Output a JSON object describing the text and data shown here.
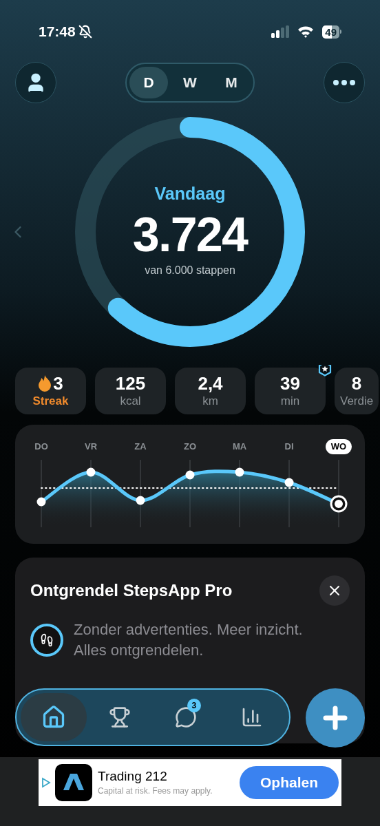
{
  "status_bar": {
    "time": "17:48",
    "battery": "49"
  },
  "period_tabs": [
    {
      "label": "D",
      "selected": true
    },
    {
      "label": "W",
      "selected": false
    },
    {
      "label": "M",
      "selected": false
    }
  ],
  "progress": {
    "title": "Vandaag",
    "steps": "3.724",
    "goal": "van 6.000 stappen",
    "level": 0.62
  },
  "stats": [
    {
      "kind": "streak",
      "value": "3",
      "label": "Streak",
      "badge": false
    },
    {
      "kind": "plain",
      "value": "125",
      "label": "kcal",
      "badge": false
    },
    {
      "kind": "plain",
      "value": "2,4",
      "label": "km",
      "badge": false
    },
    {
      "kind": "plain",
      "value": "39",
      "label": "min",
      "badge": true
    },
    {
      "kind": "plain",
      "value": "8",
      "label": "Verdie",
      "badge": false
    }
  ],
  "week_chart": {
    "days": [
      {
        "label": "DO",
        "selected": false
      },
      {
        "label": "VR",
        "selected": false
      },
      {
        "label": "ZA",
        "selected": false
      },
      {
        "label": "ZO",
        "selected": false
      },
      {
        "label": "MA",
        "selected": false
      },
      {
        "label": "DI",
        "selected": false
      },
      {
        "label": "WO",
        "selected": true
      }
    ]
  },
  "promo": {
    "title": "Ontgrendel StepsApp Pro",
    "text": "Zonder advertenties. Meer inzicht. Alles ontgrendelen."
  },
  "tab_bar": {
    "items": [
      {
        "kind": "home",
        "selected": true
      },
      {
        "kind": "trophy",
        "selected": false
      },
      {
        "kind": "chat",
        "selected": false,
        "badge": "3"
      },
      {
        "kind": "stats",
        "selected": false
      }
    ]
  },
  "ad": {
    "title": "Trading 212",
    "subtitle": "Capital at risk. Fees may apply.",
    "button": "Ophalen"
  }
}
